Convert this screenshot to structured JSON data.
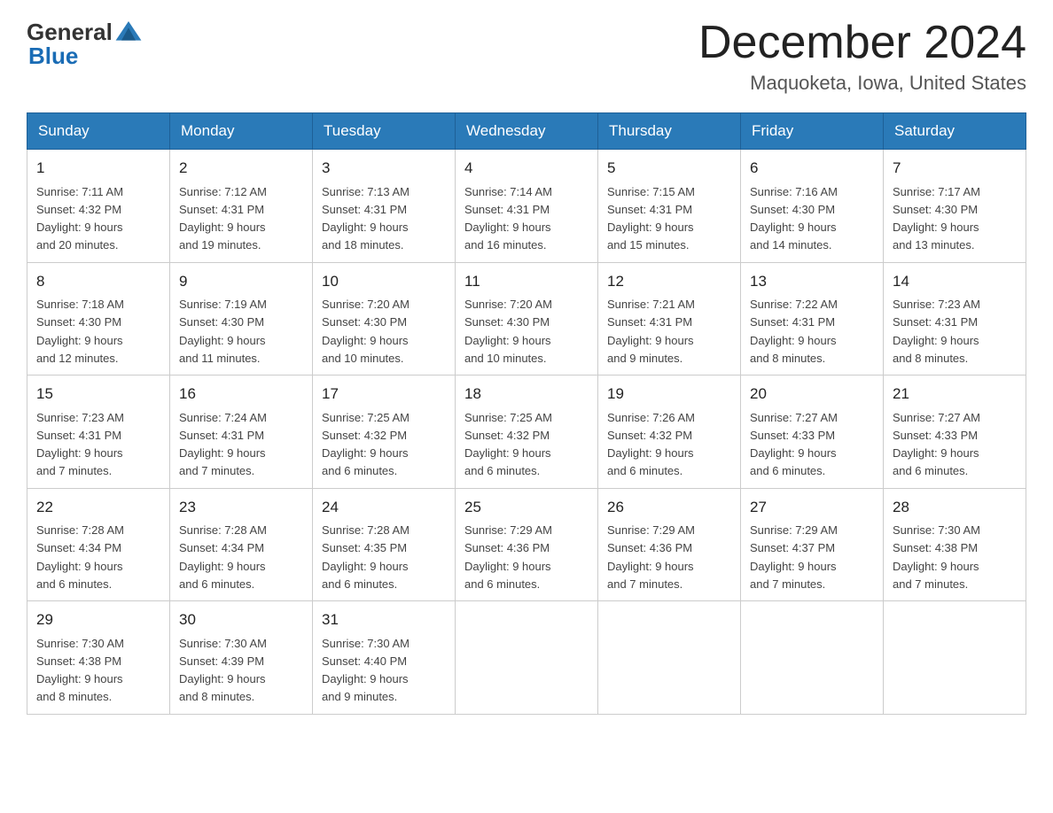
{
  "logo": {
    "general_text": "General",
    "blue_text": "Blue"
  },
  "title": {
    "month": "December 2024",
    "location": "Maquoketa, Iowa, United States"
  },
  "weekdays": [
    "Sunday",
    "Monday",
    "Tuesday",
    "Wednesday",
    "Thursday",
    "Friday",
    "Saturday"
  ],
  "weeks": [
    [
      {
        "day": "1",
        "sunrise": "7:11 AM",
        "sunset": "4:32 PM",
        "daylight": "9 hours and 20 minutes."
      },
      {
        "day": "2",
        "sunrise": "7:12 AM",
        "sunset": "4:31 PM",
        "daylight": "9 hours and 19 minutes."
      },
      {
        "day": "3",
        "sunrise": "7:13 AM",
        "sunset": "4:31 PM",
        "daylight": "9 hours and 18 minutes."
      },
      {
        "day": "4",
        "sunrise": "7:14 AM",
        "sunset": "4:31 PM",
        "daylight": "9 hours and 16 minutes."
      },
      {
        "day": "5",
        "sunrise": "7:15 AM",
        "sunset": "4:31 PM",
        "daylight": "9 hours and 15 minutes."
      },
      {
        "day": "6",
        "sunrise": "7:16 AM",
        "sunset": "4:30 PM",
        "daylight": "9 hours and 14 minutes."
      },
      {
        "day": "7",
        "sunrise": "7:17 AM",
        "sunset": "4:30 PM",
        "daylight": "9 hours and 13 minutes."
      }
    ],
    [
      {
        "day": "8",
        "sunrise": "7:18 AM",
        "sunset": "4:30 PM",
        "daylight": "9 hours and 12 minutes."
      },
      {
        "day": "9",
        "sunrise": "7:19 AM",
        "sunset": "4:30 PM",
        "daylight": "9 hours and 11 minutes."
      },
      {
        "day": "10",
        "sunrise": "7:20 AM",
        "sunset": "4:30 PM",
        "daylight": "9 hours and 10 minutes."
      },
      {
        "day": "11",
        "sunrise": "7:20 AM",
        "sunset": "4:30 PM",
        "daylight": "9 hours and 10 minutes."
      },
      {
        "day": "12",
        "sunrise": "7:21 AM",
        "sunset": "4:31 PM",
        "daylight": "9 hours and 9 minutes."
      },
      {
        "day": "13",
        "sunrise": "7:22 AM",
        "sunset": "4:31 PM",
        "daylight": "9 hours and 8 minutes."
      },
      {
        "day": "14",
        "sunrise": "7:23 AM",
        "sunset": "4:31 PM",
        "daylight": "9 hours and 8 minutes."
      }
    ],
    [
      {
        "day": "15",
        "sunrise": "7:23 AM",
        "sunset": "4:31 PM",
        "daylight": "9 hours and 7 minutes."
      },
      {
        "day": "16",
        "sunrise": "7:24 AM",
        "sunset": "4:31 PM",
        "daylight": "9 hours and 7 minutes."
      },
      {
        "day": "17",
        "sunrise": "7:25 AM",
        "sunset": "4:32 PM",
        "daylight": "9 hours and 6 minutes."
      },
      {
        "day": "18",
        "sunrise": "7:25 AM",
        "sunset": "4:32 PM",
        "daylight": "9 hours and 6 minutes."
      },
      {
        "day": "19",
        "sunrise": "7:26 AM",
        "sunset": "4:32 PM",
        "daylight": "9 hours and 6 minutes."
      },
      {
        "day": "20",
        "sunrise": "7:27 AM",
        "sunset": "4:33 PM",
        "daylight": "9 hours and 6 minutes."
      },
      {
        "day": "21",
        "sunrise": "7:27 AM",
        "sunset": "4:33 PM",
        "daylight": "9 hours and 6 minutes."
      }
    ],
    [
      {
        "day": "22",
        "sunrise": "7:28 AM",
        "sunset": "4:34 PM",
        "daylight": "9 hours and 6 minutes."
      },
      {
        "day": "23",
        "sunrise": "7:28 AM",
        "sunset": "4:34 PM",
        "daylight": "9 hours and 6 minutes."
      },
      {
        "day": "24",
        "sunrise": "7:28 AM",
        "sunset": "4:35 PM",
        "daylight": "9 hours and 6 minutes."
      },
      {
        "day": "25",
        "sunrise": "7:29 AM",
        "sunset": "4:36 PM",
        "daylight": "9 hours and 6 minutes."
      },
      {
        "day": "26",
        "sunrise": "7:29 AM",
        "sunset": "4:36 PM",
        "daylight": "9 hours and 7 minutes."
      },
      {
        "day": "27",
        "sunrise": "7:29 AM",
        "sunset": "4:37 PM",
        "daylight": "9 hours and 7 minutes."
      },
      {
        "day": "28",
        "sunrise": "7:30 AM",
        "sunset": "4:38 PM",
        "daylight": "9 hours and 7 minutes."
      }
    ],
    [
      {
        "day": "29",
        "sunrise": "7:30 AM",
        "sunset": "4:38 PM",
        "daylight": "9 hours and 8 minutes."
      },
      {
        "day": "30",
        "sunrise": "7:30 AM",
        "sunset": "4:39 PM",
        "daylight": "9 hours and 8 minutes."
      },
      {
        "day": "31",
        "sunrise": "7:30 AM",
        "sunset": "4:40 PM",
        "daylight": "9 hours and 9 minutes."
      },
      null,
      null,
      null,
      null
    ]
  ],
  "labels": {
    "sunrise": "Sunrise:",
    "sunset": "Sunset:",
    "daylight": "Daylight:"
  }
}
